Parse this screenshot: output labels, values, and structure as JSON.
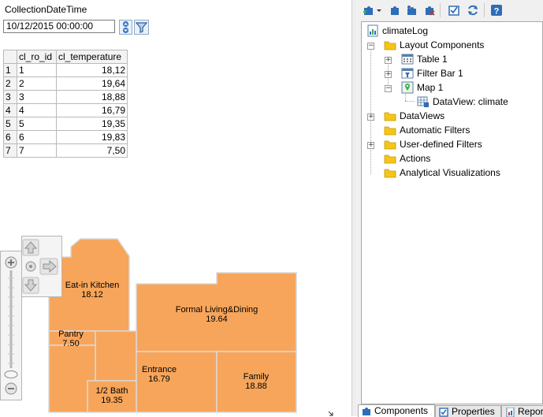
{
  "filter": {
    "label": "CollectionDateTime",
    "value": "10/12/2015 00:00:00"
  },
  "table": {
    "headers": [
      "",
      "cl_ro_id",
      "cl_temperature"
    ],
    "rows": [
      [
        "1",
        "1",
        "18,12"
      ],
      [
        "2",
        "2",
        "19,64"
      ],
      [
        "3",
        "3",
        "18,88"
      ],
      [
        "4",
        "4",
        "16,79"
      ],
      [
        "5",
        "5",
        "19,35"
      ],
      [
        "6",
        "6",
        "19,83"
      ],
      [
        "7",
        "7",
        "7,50"
      ]
    ]
  },
  "map": {
    "fill_color": "#f7a55a",
    "rooms": {
      "kitchen": {
        "name": "Eat-in  Kitchen",
        "value": "18.12"
      },
      "living": {
        "name": "Formal Living&Dining",
        "value": "19.64"
      },
      "pantry": {
        "name": "Pantry",
        "value": "7.50"
      },
      "entrance": {
        "name": "Entrance",
        "value": "16.79"
      },
      "family": {
        "name": "Family",
        "value": "18.88"
      },
      "bath": {
        "name": "1/2 Bath",
        "value": "19.35"
      }
    }
  },
  "tree": {
    "root": "climateLog",
    "layout_components": "Layout Components",
    "table1": "Table 1",
    "filterbar1": "Filter Bar 1",
    "map1": "Map 1",
    "dataview_climate": "DataView: climate",
    "dataviews": "DataViews",
    "automatic_filters": "Automatic Filters",
    "user_filters": "User-defined Filters",
    "actions": "Actions",
    "analytical_viz": "Analytical Visualizations"
  },
  "bottom_tabs": [
    "Components",
    "Properties",
    "Repor"
  ],
  "colors": {
    "folder": "#f5c518",
    "accent_blue": "#1f5fa8"
  }
}
